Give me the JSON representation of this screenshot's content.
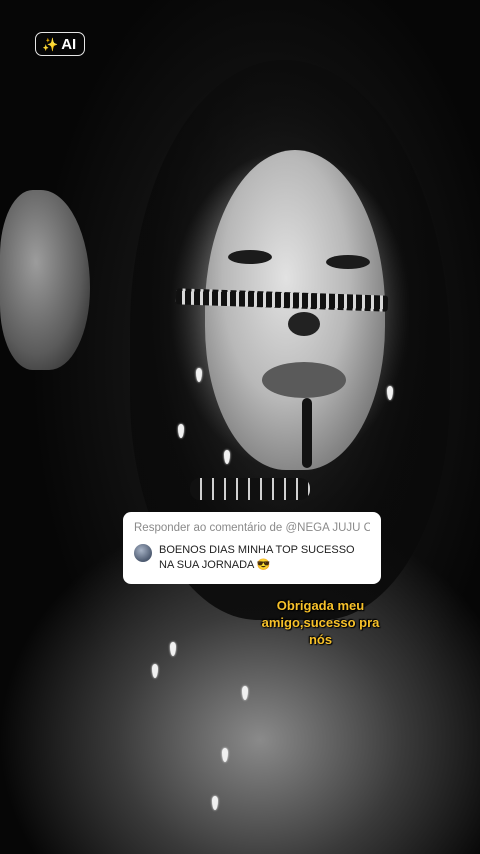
{
  "badge": {
    "label": "AI",
    "icon": "sparkle-icon"
  },
  "reply": {
    "header": "Responder ao comentário de @NEGA JUJU C...",
    "comment": "BOENOS DIAS MINHA TOP SUCESSO NA SUA JORNADA 😎"
  },
  "caption": {
    "text": "Obrigada meu amigo,sucesso pra nós"
  },
  "colors": {
    "caption": "#f7c12a",
    "card": "#ffffff"
  }
}
